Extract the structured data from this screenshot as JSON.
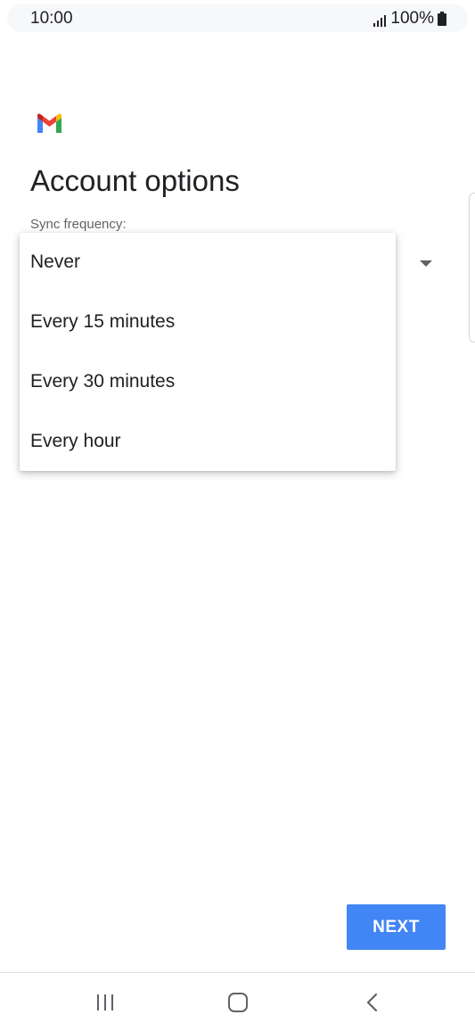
{
  "status_bar": {
    "time": "10:00",
    "battery": "100%"
  },
  "icons": {
    "app_logo": "gmail-logo-icon",
    "signal": "signal-bars-icon",
    "battery": "battery-icon",
    "dropdown": "dropdown-arrow-icon",
    "recents": "recent-apps-icon",
    "home": "home-icon",
    "back": "back-chevron-icon"
  },
  "page": {
    "title": "Account options",
    "sync_label": "Sync frequency:"
  },
  "sync_options": [
    {
      "label": "Never"
    },
    {
      "label": "Every 15 minutes"
    },
    {
      "label": "Every 30 minutes"
    },
    {
      "label": "Every hour"
    }
  ],
  "actions": {
    "next_label": "NEXT"
  },
  "colors": {
    "accent": "#4285f4",
    "gmail_red": "#ea4335",
    "gmail_blue": "#4285f4",
    "gmail_green": "#34a853",
    "gmail_yellow": "#fbbc04",
    "text_primary": "#202124",
    "text_secondary": "#5f6368"
  }
}
